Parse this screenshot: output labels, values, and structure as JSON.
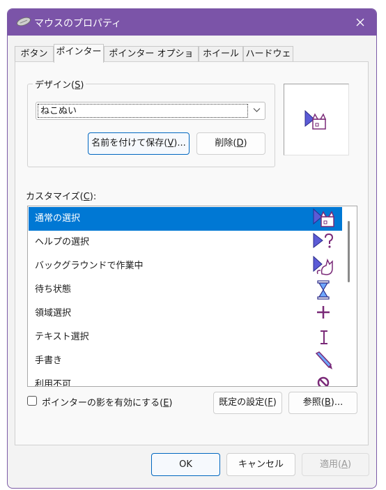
{
  "window": {
    "title": "マウスのプロパティ"
  },
  "tabs": [
    {
      "label": "ボタン"
    },
    {
      "label": "ポインター"
    },
    {
      "label": "ポインター オプション"
    },
    {
      "label": "ホイール"
    },
    {
      "label": "ハードウェア"
    }
  ],
  "design": {
    "group_label": "デザイン(S)",
    "group_label_main": "デザイン(",
    "group_label_key": "S",
    "group_label_end": ")",
    "scheme_value": "ねこぬい",
    "save_as_main": "名前を付けて保存(",
    "save_as_key": "V",
    "save_as_end": ")...",
    "delete_main": "削除(",
    "delete_key": "D",
    "delete_end": ")"
  },
  "customize": {
    "label_main": "カスタマイズ(",
    "label_key": "C",
    "label_end": "):",
    "items": [
      {
        "label": "通常の選択",
        "icon": "normal-select-cursor-icon",
        "selected": true
      },
      {
        "label": "ヘルプの選択",
        "icon": "help-select-cursor-icon",
        "selected": false
      },
      {
        "label": "バックグラウンドで作業中",
        "icon": "working-in-background-cursor-icon",
        "selected": false
      },
      {
        "label": "待ち状態",
        "icon": "busy-hourglass-cursor-icon",
        "selected": false
      },
      {
        "label": "領域選択",
        "icon": "precision-select-cross-icon",
        "selected": false
      },
      {
        "label": "テキスト選択",
        "icon": "text-select-ibeam-icon",
        "selected": false
      },
      {
        "label": "手書き",
        "icon": "handwriting-pen-icon",
        "selected": false
      },
      {
        "label": "利用不可",
        "icon": "unavailable-icon",
        "selected": false
      }
    ]
  },
  "shadow": {
    "label_main": "ポインターの影を有効にする(",
    "label_key": "E",
    "label_end": ")",
    "checked": false
  },
  "buttons": {
    "default_main": "既定の設定(",
    "default_key": "F",
    "default_end": ")",
    "browse_main": "参照(",
    "browse_key": "B",
    "browse_end": ")...",
    "ok": "OK",
    "cancel": "キャンセル",
    "apply_main": "適用(",
    "apply_key": "A",
    "apply_end": ")"
  },
  "colors": {
    "titlebar": "#7b54a8",
    "selection": "#0078d4",
    "cursor_fill": "#5b5bd6",
    "cursor_accent": "#7a2a78"
  }
}
